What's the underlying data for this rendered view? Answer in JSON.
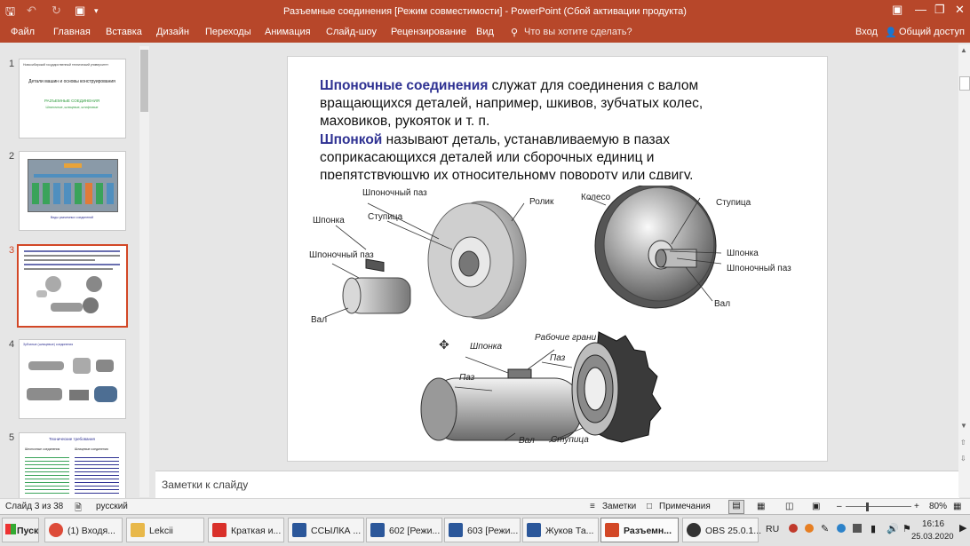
{
  "titlebar": {
    "title": "Разъемные соединения [Режим совместимости] - PowerPoint (Сбой активации продукта)",
    "accent": "#b7472a"
  },
  "ribbon": {
    "tabs": [
      "Файл",
      "Главная",
      "Вставка",
      "Дизайн",
      "Переходы",
      "Анимация",
      "Слайд-шоу",
      "Рецензирование",
      "Вид"
    ],
    "tell_me": "Что вы хотите сделать?",
    "login": "Вход",
    "share": "Общий доступ"
  },
  "thumbnails": {
    "numbers": [
      "1",
      "2",
      "3",
      "4",
      "5"
    ],
    "thumb1": {
      "header": "Новосибирский государственный технический университет",
      "title": "Детали машин и основы конструирования",
      "subtitle": "РАЗЪЕМНЫЕ СОЕДИНЕНИЯ",
      "sub2": "Шпоночные, шлицевые, штифтовые"
    },
    "thumb2": {
      "caption": "Виды разъемных соединений"
    },
    "thumb4": {
      "caption": "Зубчатые (шлицевые) соединения"
    },
    "thumb5": {
      "title": "Технические требования",
      "col1": "Шпоночные соединения",
      "col2": "Шлицевые соединения"
    }
  },
  "slide": {
    "p1_term": "Шпоночные соединения",
    "p1_l1": " служат  для соединения с валом",
    "p1_l2": "вращающихся деталей, например, шкивов, зубчатых колес,",
    "p1_l3": "маховиков, рукояток и т. п.",
    "p2_term": "Шпонкой",
    "p2_l1": " называют деталь, устанавливаемую в пазах",
    "p2_l2": "соприкасающихся деталей или сборочных единиц и",
    "p2_l3": "препятствующую их относительному повороту или сдвигу.",
    "labels": {
      "shp_paz": "Шпоночный паз",
      "stupica1": "Ступица",
      "rolik": "Ролик",
      "shponka1": "Шпонка",
      "shp_paz2": "Шпоночный паз",
      "val1": "Вал",
      "koleso": "Колесо",
      "stupica2": "Ступица",
      "shponka2": "Шпонка",
      "shp_paz3": "Шпоночный паз",
      "val2": "Вал",
      "shponka3": "Шпонка",
      "rab_grani": "Рабочие грани",
      "paz1": "Паз",
      "paz2": "Паз",
      "val3": "Вал",
      "stupica3": "Ступица"
    },
    "title_color": "#2e3192"
  },
  "notes": {
    "placeholder": "Заметки к слайду"
  },
  "status": {
    "slide_info": "Слайд 3 из 38",
    "language": "русский",
    "notes": "Заметки",
    "comments": "Примечания",
    "zoom": "80%"
  },
  "taskbar": {
    "start": "Пуск",
    "items": [
      {
        "label": "(1) Входя...",
        "color": "#dd4b39"
      },
      {
        "label": "Lekcii",
        "color": "#e8b84a"
      },
      {
        "label": "Краткая и...",
        "color": "#d9302a"
      },
      {
        "label": "ССЫЛКА ...",
        "color": "#2b579a"
      },
      {
        "label": "602 [Режи...",
        "color": "#2b579a"
      },
      {
        "label": "603 [Режи...",
        "color": "#2b579a"
      },
      {
        "label": "Жуков Та...",
        "color": "#2b579a"
      },
      {
        "label": "Разъемн...",
        "color": "#d24726"
      },
      {
        "label": "OBS 25.0.1...",
        "color": "#333333"
      }
    ],
    "lang": "RU",
    "time": "16:16",
    "date": "25.03.2020"
  }
}
